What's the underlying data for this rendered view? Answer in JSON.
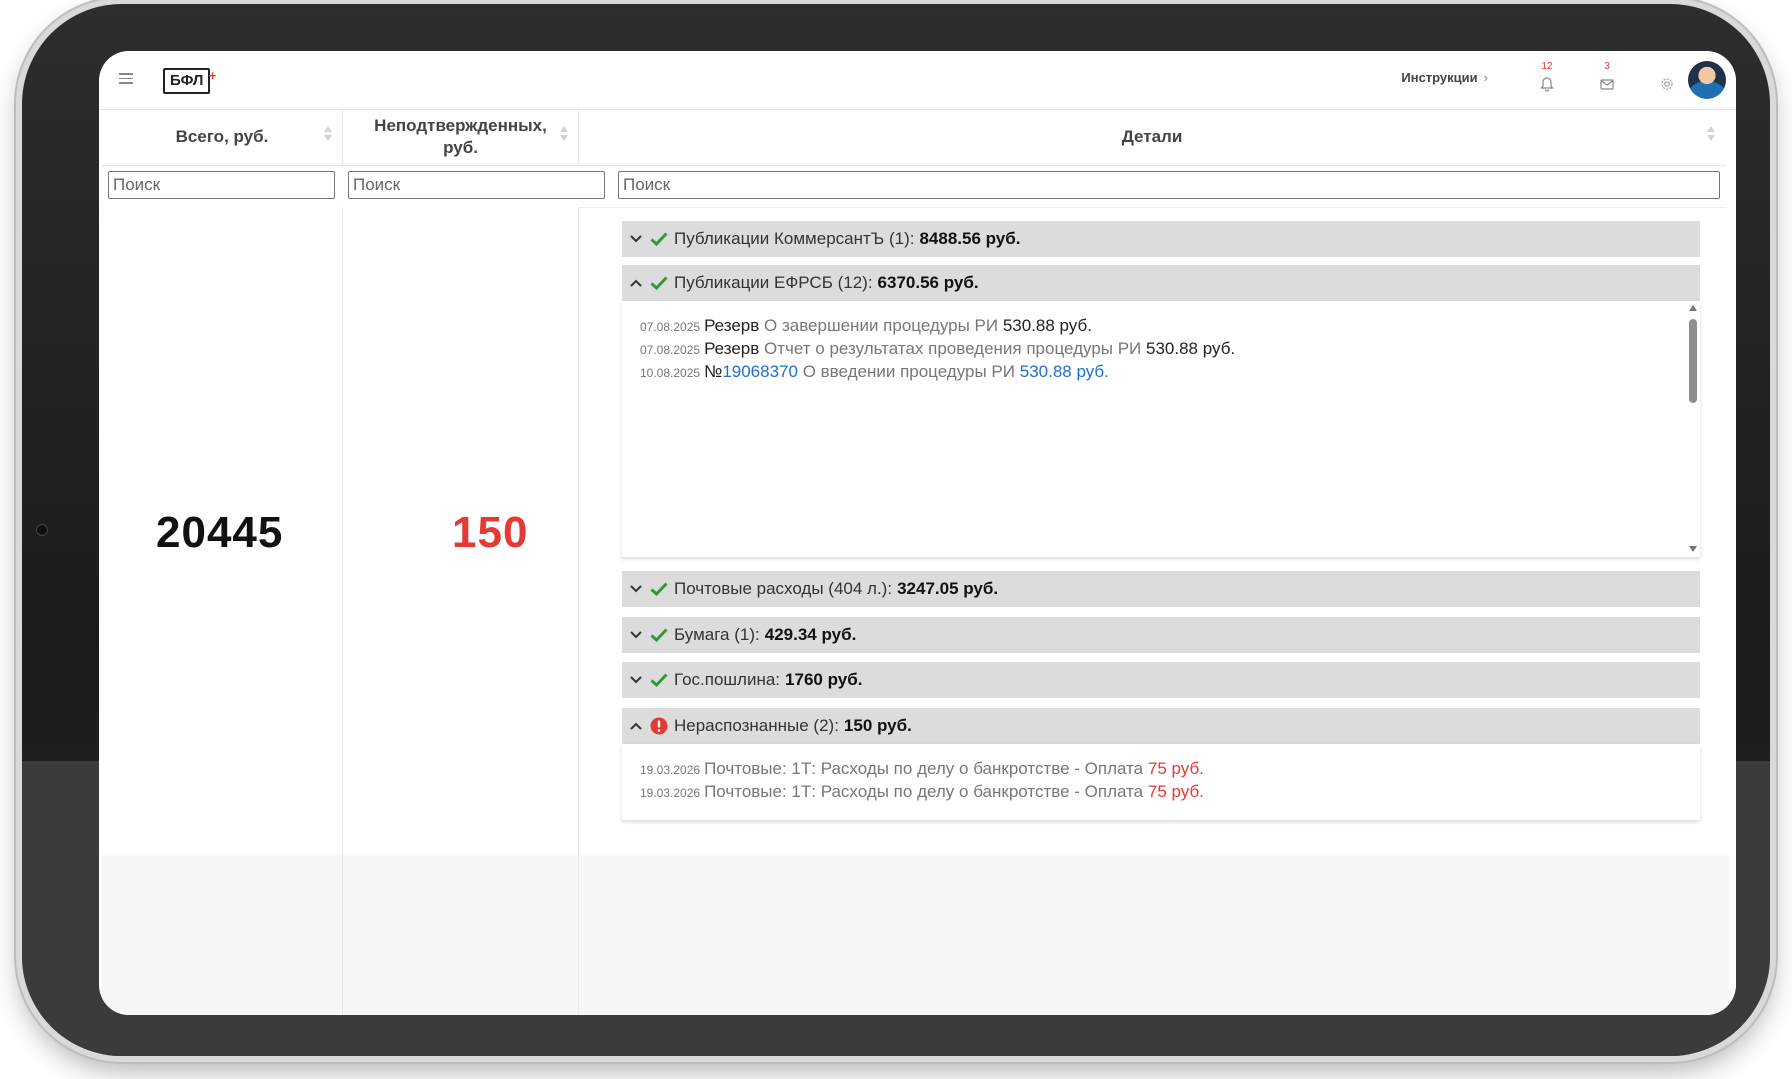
{
  "header": {
    "logo": "БФЛ",
    "logo_plus": "+",
    "instructions_label": "Инструкции",
    "instructions_chevron": "›",
    "notifications_count": "12",
    "messages_count": "3"
  },
  "table": {
    "columns": [
      {
        "label": "Всего, руб."
      },
      {
        "label": "Неподтвержденных, руб."
      },
      {
        "label": "Детали"
      }
    ],
    "search_placeholder": "Поиск",
    "total": "20445",
    "unconfirmed": "150"
  },
  "details": {
    "kommersant": {
      "label": "Публикации КоммерсантЪ (1):",
      "amount": "8488.56 руб."
    },
    "efrsb": {
      "label": "Публикации ЕФРСБ (12):",
      "amount": "6370.56 руб.",
      "rows": [
        {
          "date": "07.08.2025",
          "kind": "Резерв",
          "text": "О завершении процедуры РИ",
          "amount": "530.88 руб."
        },
        {
          "date": "07.08.2025",
          "kind": "Резерв",
          "text": "Отчет о результатах проведения процедуры РИ",
          "amount": "530.88 руб."
        },
        {
          "date": "10.08.2025",
          "num_prefix": "№",
          "num": "19068370",
          "text": "О введении процедуры РИ",
          "amount": "530.88 руб."
        }
      ]
    },
    "postal": {
      "label": "Почтовые расходы (404 л.):",
      "amount": "3247.05 руб."
    },
    "paper": {
      "label": "Бумага (1):",
      "amount": "429.34 руб."
    },
    "duty": {
      "label": "Гос.пошлина:",
      "amount": "1760 руб."
    },
    "unrecognized": {
      "label": "Нераспознанные (2):",
      "amount": "150 руб.",
      "rows": [
        {
          "date": "19.03.2026",
          "text": "Почтовые: 1Т: Расходы по делу о банкротстве - Оплата",
          "amount": "75 руб."
        },
        {
          "date": "19.03.2026",
          "text": "Почтовые: 1Т: Расходы по делу о банкротстве - Оплата",
          "amount": "75 руб."
        }
      ]
    }
  },
  "colors": {
    "accent_red": "#e53935",
    "link_blue": "#1e6fcc",
    "check_green": "#2e9a3a",
    "group_header_bg": "#dcdcdc"
  },
  "icons": [
    "hamburger-menu-icon",
    "bell-icon",
    "mail-icon",
    "gear-icon",
    "chevron-down-icon",
    "chevron-up-icon",
    "check-icon",
    "error-icon",
    "sort-icon"
  ]
}
